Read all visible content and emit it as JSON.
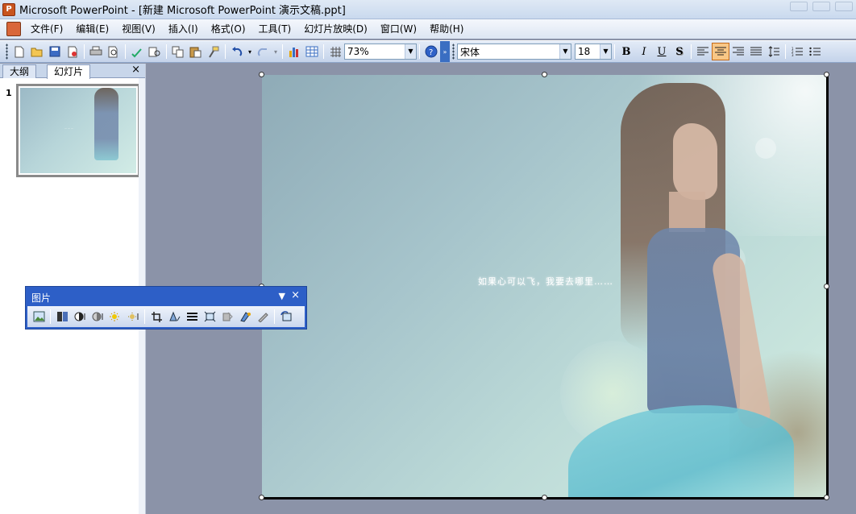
{
  "window": {
    "title": "Microsoft PowerPoint - [新建 Microsoft PowerPoint 演示文稿.ppt]"
  },
  "menu": {
    "items": [
      "文件(F)",
      "编辑(E)",
      "视图(V)",
      "插入(I)",
      "格式(O)",
      "工具(T)",
      "幻灯片放映(D)",
      "窗口(W)",
      "帮助(H)"
    ]
  },
  "toolbar": {
    "zoom": "73%",
    "font_name": "宋体",
    "font_size": "18",
    "bold_label": "B",
    "italic_label": "I",
    "underline_label": "U",
    "shadow_label": "S",
    "icons": [
      "new-icon",
      "open-icon",
      "save-icon",
      "permission-icon",
      "print-icon",
      "print-preview-icon",
      "spelling-icon",
      "research-icon",
      "copy-icon",
      "paste-icon",
      "format-painter-icon",
      "undo-icon",
      "redo-icon",
      "chart-icon",
      "table-icon",
      "grid-icon",
      "help-icon",
      "align-left-icon",
      "center-icon",
      "align-right-icon",
      "distributed-icon",
      "line-spacing-icon",
      "numbering-icon",
      "bullets-icon"
    ]
  },
  "left_pane": {
    "tab_outline": "大纲",
    "tab_slides": "幻灯片",
    "close": "×",
    "slide_number": "1"
  },
  "slide": {
    "caption": "如果心可以飞，我要去哪里……"
  },
  "picture_toolbar": {
    "title": "图片",
    "close": "×",
    "icons": [
      "insert-picture-icon",
      "color-icon",
      "more-contrast-icon",
      "less-contrast-icon",
      "more-brightness-icon",
      "less-brightness-icon",
      "crop-icon",
      "rotate-left-icon",
      "line-style-icon",
      "compress-pictures-icon",
      "recolor-icon",
      "format-picture-icon",
      "set-transparent-color-icon",
      "reset-picture-icon"
    ]
  },
  "colors": {
    "title_bar": "#c9d9ee",
    "toolbar_active": "#f8c786",
    "picture_toolbar": "#2d5fc7",
    "workspace": "#8b93a8"
  }
}
